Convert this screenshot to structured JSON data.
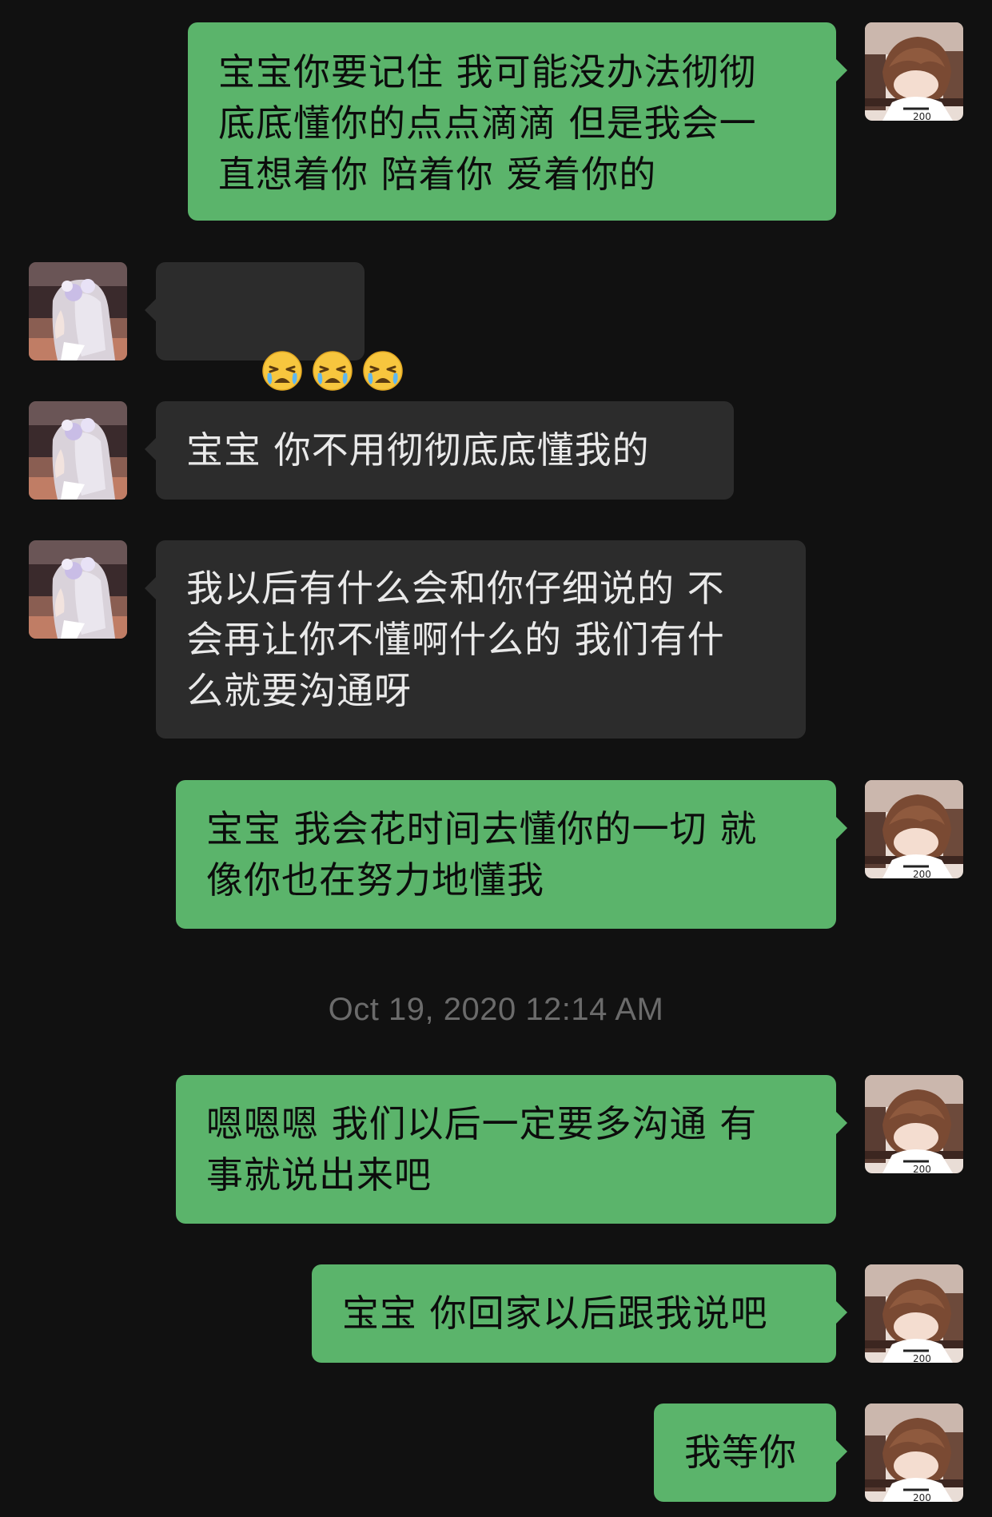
{
  "conversation": {
    "timestamp": "Oct 19, 2020 12:14 AM",
    "messages": [
      {
        "sender": "me",
        "text": "宝宝你要记住 我可能没办法彻彻\n底底懂你的点点滴滴 但是我会一\n直想着你 陪着你 爱着你的"
      },
      {
        "sender": "them",
        "text": "",
        "emoji": [
          "crying-face",
          "crying-face",
          "crying-face"
        ]
      },
      {
        "sender": "them",
        "text": "宝宝 你不用彻彻底底懂我的"
      },
      {
        "sender": "them",
        "text": "我以后有什么会和你仔细说的 不\n会再让你不懂啊什么的 我们有什\n么就要沟通呀"
      },
      {
        "sender": "me",
        "text": "宝宝 我会花时间去懂你的一切 就\n像你也在努力地懂我"
      },
      {
        "sender": "me",
        "text": "嗯嗯嗯 我们以后一定要多沟通 有\n事就说出来吧"
      },
      {
        "sender": "me",
        "text": "宝宝 你回家以后跟我说吧"
      },
      {
        "sender": "me",
        "text": "我等你"
      }
    ]
  },
  "colors": {
    "background": "#111111",
    "outgoing_bubble": "#5bb46b",
    "incoming_bubble": "#2c2c2c",
    "timestamp_text": "#6b6b6b"
  }
}
